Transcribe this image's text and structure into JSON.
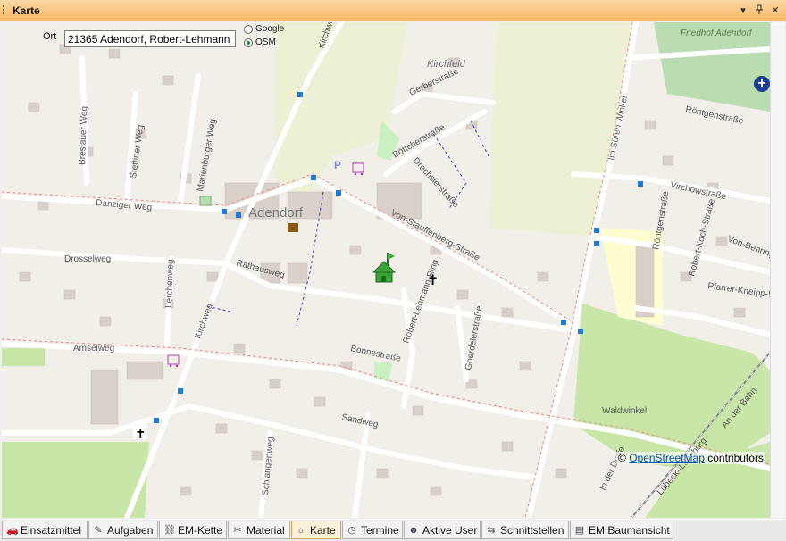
{
  "window": {
    "title": "Karte"
  },
  "window_buttons": [
    {
      "name": "dropdown-icon",
      "glyph": "▾"
    },
    {
      "name": "pin-icon",
      "glyph": "📌"
    },
    {
      "name": "close-icon",
      "glyph": "✕"
    }
  ],
  "search": {
    "label": "Ort",
    "value": "21365 Adendorf, Robert-Lehmann"
  },
  "map_source": {
    "options": [
      "Google",
      "OSM"
    ],
    "selected": "OSM"
  },
  "attribution": {
    "prefix": "© ",
    "link": "OpenStreetMap",
    "suffix": " contributors"
  },
  "map_labels": {
    "town": "Adendorf",
    "cemetery": "Friedhof Adendorf",
    "district": "Kirchfeld",
    "streets": {
      "kirchweg": "Kirchweg",
      "breslauer": "Breslauer Weg",
      "stettiner": "Stettiner Weg",
      "marienburger": "Marienburger Weg",
      "danziger": "Danziger Weg",
      "drosselweg": "Drosselweg",
      "lerchenweg": "Lerchenweg",
      "rathausweg": "Rathausweg",
      "amselweg": "Amselweg",
      "bonnestrasse": "Bonnestraße",
      "sandweg": "Sandweg",
      "schlangenweg": "Schlangenweg",
      "gerberstrasse": "Gerberstraße",
      "boettcher": "Böttcherstraße",
      "drechsler": "Drechslerstraße",
      "stauffenberg": "Von-Stauffenberg-Straße",
      "lehmann": "Robert-Lehmann-Ring",
      "goerdeler": "Goerdelerstraße",
      "suren": "Im Suren Winkel",
      "rontgen1": "Röntgenstraße",
      "virchow": "Virchowstraße",
      "rontgen2": "Röntgenstraße",
      "koch": "Robert-Koch-Straße",
      "behring": "Von-Behring-",
      "kneipp": "Pfarrer-Kneipp-Weg",
      "waldwinkel": "Waldwinkel",
      "dorfe": "In der Dorfe",
      "bahn": "An der Bahn",
      "lueneburg": "Lübeck–Lüneburg",
      "kirchweg2": "Kirchweg"
    }
  },
  "tabs": [
    {
      "label": "Einsatzmittel",
      "icon": "vehicle-icon",
      "glyph": "🚗"
    },
    {
      "label": "Aufgaben",
      "icon": "tasks-icon",
      "glyph": "✎"
    },
    {
      "label": "EM-Kette",
      "icon": "chain-icon",
      "glyph": "⛓"
    },
    {
      "label": "Material",
      "icon": "material-icon",
      "glyph": "✂"
    },
    {
      "label": "Karte",
      "icon": "map-icon",
      "glyph": "☼",
      "active": true
    },
    {
      "label": "Termine",
      "icon": "clock-icon",
      "glyph": "◷"
    },
    {
      "label": "Aktive User",
      "icon": "users-icon",
      "glyph": "☻"
    },
    {
      "label": "Schnittstellen",
      "icon": "interfaces-icon",
      "glyph": "⇆"
    },
    {
      "label": "EM Baumansicht",
      "icon": "tree-view-icon",
      "glyph": "▤"
    }
  ],
  "colors": {
    "titlebar": "#f7b765",
    "active_tab": "#fff0d8",
    "map_bg": "#f2efe9",
    "farmland": "#eef0d5",
    "park": "#c8e6a8",
    "marker": "#3aa33a"
  }
}
